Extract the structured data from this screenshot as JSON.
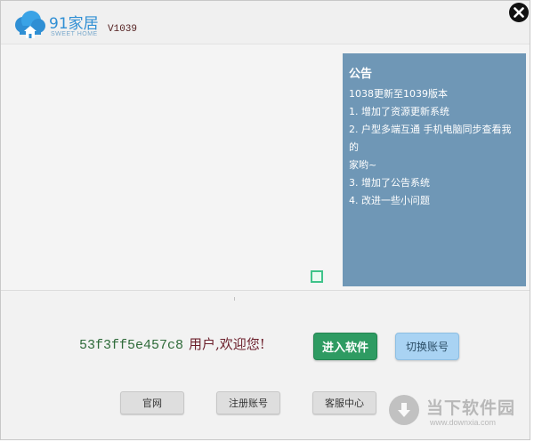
{
  "header": {
    "logo_main": "91家居",
    "logo_sub": "SWEET HOME",
    "version": "V1039"
  },
  "notice": {
    "title": "公告",
    "lines": [
      "1038更新至1039版本",
      "1. 增加了资源更新系统",
      "2. 户型多端互通 手机电脑同步查看我的",
      "家哟~",
      "3. 增加了公告系统",
      "4. 改进一些小问题"
    ]
  },
  "welcome": {
    "user_id": "53f3ff5e457c8",
    "text": "用户,欢迎您!"
  },
  "buttons": {
    "enter": "进入软件",
    "switch": "切换账号",
    "website": "官网",
    "register": "注册账号",
    "support": "客服中心"
  },
  "watermark": {
    "text": "当下软件园",
    "sub": "www.downxia.com"
  },
  "colors": {
    "notice_bg": "#6f97b6",
    "enter_bg": "#2e9b62",
    "switch_bg": "#a9d3f3",
    "brand_blue": "#2f8fd4"
  }
}
